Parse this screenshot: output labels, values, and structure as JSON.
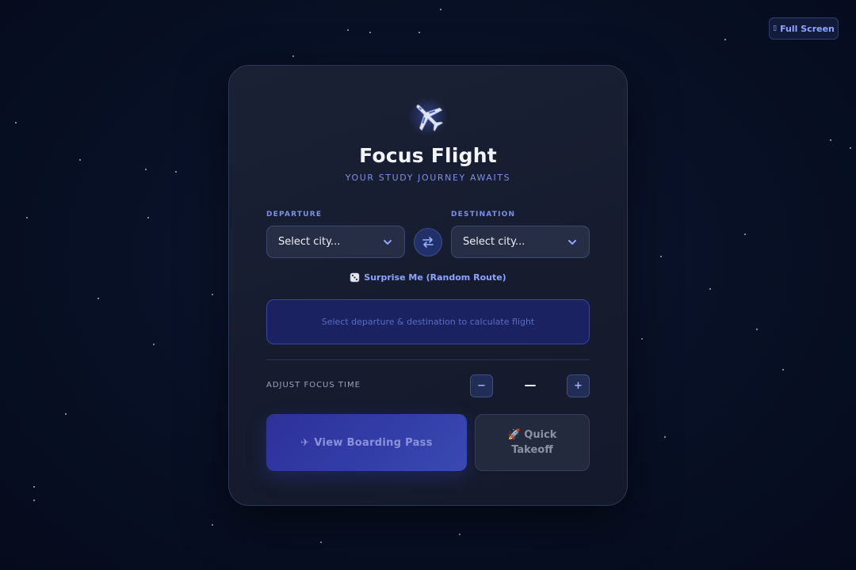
{
  "header": {
    "fullscreen_icon": "expand-icon",
    "fullscreen_label": "Full Screen"
  },
  "app": {
    "title": "Focus Flight",
    "subtitle": "YOUR STUDY JOURNEY AWAITS",
    "logo_icon": "airplane-icon"
  },
  "route": {
    "departure_label": "DEPARTURE",
    "departure_value": "Select city...",
    "destination_label": "DESTINATION",
    "destination_value": "Select city...",
    "swap_icon": "swap-arrows-icon",
    "surprise_icon": "dice-icon",
    "surprise_label": "Surprise Me (Random Route)"
  },
  "flight_info": {
    "message": "Select departure & destination to calculate flight"
  },
  "focus_time": {
    "label": "ADJUST FOCUS TIME",
    "decrease": "−",
    "value": "—",
    "increase": "+"
  },
  "actions": {
    "boarding_icon": "✈",
    "boarding_label": "View Boarding Pass",
    "takeoff_icon": "🚀",
    "takeoff_label": "Quick Takeoff"
  },
  "colors": {
    "accent": "#7d8fe8",
    "background": "#081127",
    "card": "#171d2f",
    "primary_button": "#333da8"
  }
}
